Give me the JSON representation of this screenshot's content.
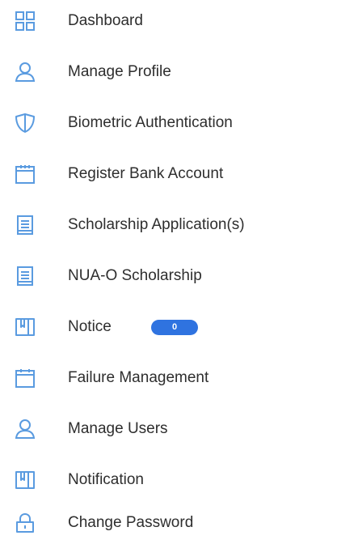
{
  "sidebar": {
    "icon_color": "#5a9be0",
    "items": [
      {
        "label": "Dashboard",
        "icon": "dashboard-grid-icon"
      },
      {
        "label": "Manage Profile",
        "icon": "user-icon"
      },
      {
        "label": "Biometric Authentication",
        "icon": "shield-icon"
      },
      {
        "label": "Register Bank Account",
        "icon": "calendar-icon"
      },
      {
        "label": "Scholarship Application(s)",
        "icon": "document-list-icon"
      },
      {
        "label": "NUA-O Scholarship",
        "icon": "document-list-icon"
      },
      {
        "label": "Notice",
        "icon": "book-icon",
        "badge": "0"
      },
      {
        "label": "Failure Management",
        "icon": "calendar-icon"
      },
      {
        "label": "Manage Users",
        "icon": "user-icon"
      },
      {
        "label": "Notification",
        "icon": "book-icon"
      },
      {
        "label": "Change Password",
        "icon": "lock-icon"
      }
    ],
    "badge_color": "#2f73e0"
  }
}
